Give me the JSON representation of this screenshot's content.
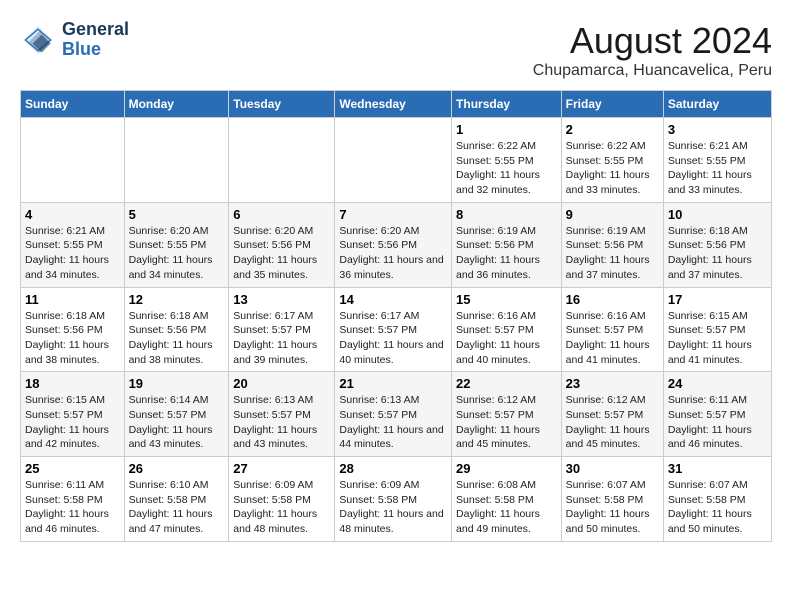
{
  "logo": {
    "line1": "General",
    "line2": "Blue"
  },
  "title": "August 2024",
  "subtitle": "Chupamarca, Huancavelica, Peru",
  "days_of_week": [
    "Sunday",
    "Monday",
    "Tuesday",
    "Wednesday",
    "Thursday",
    "Friday",
    "Saturday"
  ],
  "weeks": [
    [
      {
        "num": "",
        "sunrise": "",
        "sunset": "",
        "daylight": ""
      },
      {
        "num": "",
        "sunrise": "",
        "sunset": "",
        "daylight": ""
      },
      {
        "num": "",
        "sunrise": "",
        "sunset": "",
        "daylight": ""
      },
      {
        "num": "",
        "sunrise": "",
        "sunset": "",
        "daylight": ""
      },
      {
        "num": "1",
        "sunrise": "Sunrise: 6:22 AM",
        "sunset": "Sunset: 5:55 PM",
        "daylight": "Daylight: 11 hours and 32 minutes."
      },
      {
        "num": "2",
        "sunrise": "Sunrise: 6:22 AM",
        "sunset": "Sunset: 5:55 PM",
        "daylight": "Daylight: 11 hours and 33 minutes."
      },
      {
        "num": "3",
        "sunrise": "Sunrise: 6:21 AM",
        "sunset": "Sunset: 5:55 PM",
        "daylight": "Daylight: 11 hours and 33 minutes."
      }
    ],
    [
      {
        "num": "4",
        "sunrise": "Sunrise: 6:21 AM",
        "sunset": "Sunset: 5:55 PM",
        "daylight": "Daylight: 11 hours and 34 minutes."
      },
      {
        "num": "5",
        "sunrise": "Sunrise: 6:20 AM",
        "sunset": "Sunset: 5:55 PM",
        "daylight": "Daylight: 11 hours and 34 minutes."
      },
      {
        "num": "6",
        "sunrise": "Sunrise: 6:20 AM",
        "sunset": "Sunset: 5:56 PM",
        "daylight": "Daylight: 11 hours and 35 minutes."
      },
      {
        "num": "7",
        "sunrise": "Sunrise: 6:20 AM",
        "sunset": "Sunset: 5:56 PM",
        "daylight": "Daylight: 11 hours and 36 minutes."
      },
      {
        "num": "8",
        "sunrise": "Sunrise: 6:19 AM",
        "sunset": "Sunset: 5:56 PM",
        "daylight": "Daylight: 11 hours and 36 minutes."
      },
      {
        "num": "9",
        "sunrise": "Sunrise: 6:19 AM",
        "sunset": "Sunset: 5:56 PM",
        "daylight": "Daylight: 11 hours and 37 minutes."
      },
      {
        "num": "10",
        "sunrise": "Sunrise: 6:18 AM",
        "sunset": "Sunset: 5:56 PM",
        "daylight": "Daylight: 11 hours and 37 minutes."
      }
    ],
    [
      {
        "num": "11",
        "sunrise": "Sunrise: 6:18 AM",
        "sunset": "Sunset: 5:56 PM",
        "daylight": "Daylight: 11 hours and 38 minutes."
      },
      {
        "num": "12",
        "sunrise": "Sunrise: 6:18 AM",
        "sunset": "Sunset: 5:56 PM",
        "daylight": "Daylight: 11 hours and 38 minutes."
      },
      {
        "num": "13",
        "sunrise": "Sunrise: 6:17 AM",
        "sunset": "Sunset: 5:57 PM",
        "daylight": "Daylight: 11 hours and 39 minutes."
      },
      {
        "num": "14",
        "sunrise": "Sunrise: 6:17 AM",
        "sunset": "Sunset: 5:57 PM",
        "daylight": "Daylight: 11 hours and 40 minutes."
      },
      {
        "num": "15",
        "sunrise": "Sunrise: 6:16 AM",
        "sunset": "Sunset: 5:57 PM",
        "daylight": "Daylight: 11 hours and 40 minutes."
      },
      {
        "num": "16",
        "sunrise": "Sunrise: 6:16 AM",
        "sunset": "Sunset: 5:57 PM",
        "daylight": "Daylight: 11 hours and 41 minutes."
      },
      {
        "num": "17",
        "sunrise": "Sunrise: 6:15 AM",
        "sunset": "Sunset: 5:57 PM",
        "daylight": "Daylight: 11 hours and 41 minutes."
      }
    ],
    [
      {
        "num": "18",
        "sunrise": "Sunrise: 6:15 AM",
        "sunset": "Sunset: 5:57 PM",
        "daylight": "Daylight: 11 hours and 42 minutes."
      },
      {
        "num": "19",
        "sunrise": "Sunrise: 6:14 AM",
        "sunset": "Sunset: 5:57 PM",
        "daylight": "Daylight: 11 hours and 43 minutes."
      },
      {
        "num": "20",
        "sunrise": "Sunrise: 6:13 AM",
        "sunset": "Sunset: 5:57 PM",
        "daylight": "Daylight: 11 hours and 43 minutes."
      },
      {
        "num": "21",
        "sunrise": "Sunrise: 6:13 AM",
        "sunset": "Sunset: 5:57 PM",
        "daylight": "Daylight: 11 hours and 44 minutes."
      },
      {
        "num": "22",
        "sunrise": "Sunrise: 6:12 AM",
        "sunset": "Sunset: 5:57 PM",
        "daylight": "Daylight: 11 hours and 45 minutes."
      },
      {
        "num": "23",
        "sunrise": "Sunrise: 6:12 AM",
        "sunset": "Sunset: 5:57 PM",
        "daylight": "Daylight: 11 hours and 45 minutes."
      },
      {
        "num": "24",
        "sunrise": "Sunrise: 6:11 AM",
        "sunset": "Sunset: 5:57 PM",
        "daylight": "Daylight: 11 hours and 46 minutes."
      }
    ],
    [
      {
        "num": "25",
        "sunrise": "Sunrise: 6:11 AM",
        "sunset": "Sunset: 5:58 PM",
        "daylight": "Daylight: 11 hours and 46 minutes."
      },
      {
        "num": "26",
        "sunrise": "Sunrise: 6:10 AM",
        "sunset": "Sunset: 5:58 PM",
        "daylight": "Daylight: 11 hours and 47 minutes."
      },
      {
        "num": "27",
        "sunrise": "Sunrise: 6:09 AM",
        "sunset": "Sunset: 5:58 PM",
        "daylight": "Daylight: 11 hours and 48 minutes."
      },
      {
        "num": "28",
        "sunrise": "Sunrise: 6:09 AM",
        "sunset": "Sunset: 5:58 PM",
        "daylight": "Daylight: 11 hours and 48 minutes."
      },
      {
        "num": "29",
        "sunrise": "Sunrise: 6:08 AM",
        "sunset": "Sunset: 5:58 PM",
        "daylight": "Daylight: 11 hours and 49 minutes."
      },
      {
        "num": "30",
        "sunrise": "Sunrise: 6:07 AM",
        "sunset": "Sunset: 5:58 PM",
        "daylight": "Daylight: 11 hours and 50 minutes."
      },
      {
        "num": "31",
        "sunrise": "Sunrise: 6:07 AM",
        "sunset": "Sunset: 5:58 PM",
        "daylight": "Daylight: 11 hours and 50 minutes."
      }
    ]
  ]
}
